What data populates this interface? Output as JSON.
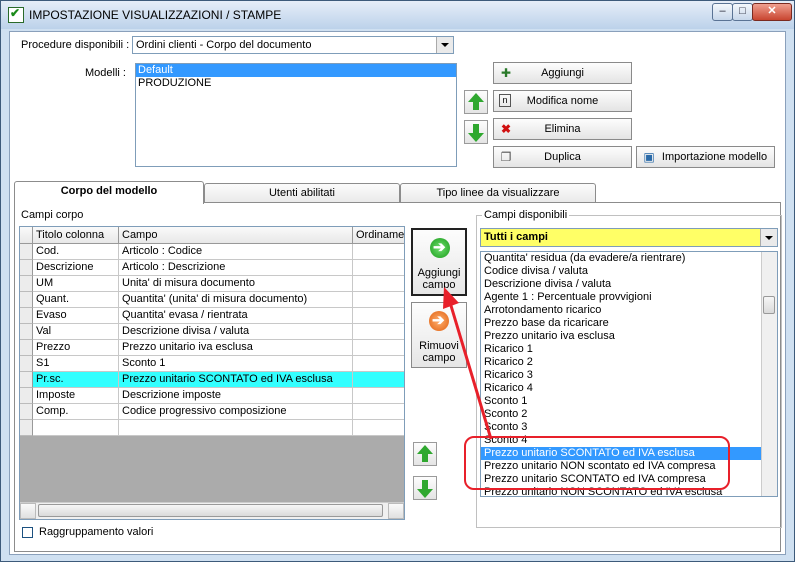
{
  "window": {
    "title": "IMPOSTAZIONE VISUALIZZAZIONI / STAMPE"
  },
  "procedures": {
    "label": "Procedure disponibili :",
    "selected": "Ordini clienti - Corpo del documento"
  },
  "models": {
    "label": "Modelli :",
    "items": [
      "Default",
      "PRODUZIONE"
    ],
    "selected_index": 0
  },
  "model_buttons": {
    "add": "Aggiungi",
    "rename": "Modifica nome",
    "delete": "Elimina",
    "duplicate": "Duplica",
    "import": "Importazione modello"
  },
  "tabs": [
    {
      "label": "Corpo del modello",
      "active": true
    },
    {
      "label": "Utenti abilitati",
      "active": false
    },
    {
      "label": "Tipo linee da visualizzare",
      "active": false
    }
  ],
  "body_fields": {
    "label": "Campi corpo",
    "columns": [
      "Titolo colonna",
      "Campo",
      "Ordiname"
    ],
    "rows": [
      {
        "title": "Cod.",
        "field": "Articolo : Codice"
      },
      {
        "title": "Descrizione",
        "field": "Articolo : Descrizione"
      },
      {
        "title": "UM",
        "field": "Unita' di misura documento"
      },
      {
        "title": "Quant.",
        "field": "Quantita' (unita' di misura documento)"
      },
      {
        "title": "Evaso",
        "field": "Quantita' evasa / rientrata"
      },
      {
        "title": "Val",
        "field": "Descrizione divisa / valuta"
      },
      {
        "title": "Prezzo",
        "field": "Prezzo unitario iva esclusa"
      },
      {
        "title": "S1",
        "field": "Sconto 1"
      },
      {
        "title": "Pr.sc.",
        "field": "Prezzo unitario SCONTATO ed IVA esclusa"
      },
      {
        "title": "Imposte",
        "field": "Descrizione imposte"
      },
      {
        "title": "Comp.",
        "field": "Codice progressivo composizione"
      },
      {
        "title": "",
        "field": ""
      }
    ],
    "selected_index": 8
  },
  "add_field_button": {
    "line1": "Aggiungi",
    "line2": "campo"
  },
  "remove_field_button": {
    "line1": "Rimuovi",
    "line2": "campo"
  },
  "available_fields": {
    "label": "Campi disponibili",
    "filter": "Tutti i campi",
    "items": [
      "Quantita' residua (da evadere/a rientrare)",
      "Codice divisa / valuta",
      "Descrizione divisa / valuta",
      "Agente 1 : Percentuale provvigioni",
      "Arrotondamento ricarico",
      "Prezzo base da ricaricare",
      "Prezzo unitario iva esclusa",
      "Ricarico 1",
      "Ricarico 2",
      "Ricarico 3",
      "Ricarico 4",
      "Sconto 1",
      "Sconto 2",
      "Sconto 3",
      "Sconto 4",
      "Prezzo unitario SCONTATO ed IVA esclusa",
      "Prezzo unitario NON scontato ed IVA compresa",
      "Prezzo unitario SCONTATO ed IVA compresa",
      "Prezzo unitario NON SCONTATO ed IVA esclusa"
    ],
    "selected_index": 15
  },
  "grouping": {
    "label": "Raggruppamento valori",
    "checked": false
  },
  "colors": {
    "accent_red": "#e8202a",
    "selected_row": "#33ffff",
    "list_selection": "#3399ff"
  }
}
